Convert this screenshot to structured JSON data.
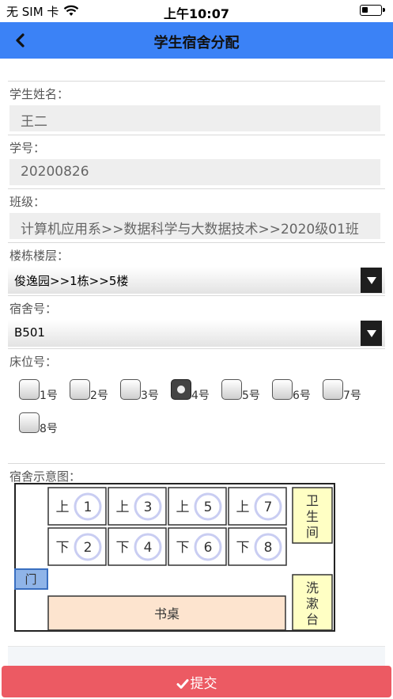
{
  "status": {
    "carrier": "无 SIM 卡",
    "time": "上午10:07"
  },
  "nav": {
    "title": "学生宿舍分配"
  },
  "form": {
    "name_label": "学生姓名：",
    "name_value": "王二",
    "id_label": "学号：",
    "id_value": "20200826",
    "class_label": "班级：",
    "class_value": "计算机应用系>>数据科学与大数据技术>>2020级01班",
    "building_label": "楼栋楼层：",
    "building_value": "俊逸园>>1栋>>5楼",
    "room_label": "宿舍号：",
    "room_value": "B501",
    "bed_label": "床位号：",
    "beds": [
      "1号",
      "2号",
      "3号",
      "4号",
      "5号",
      "6号",
      "7号",
      "8号"
    ],
    "selected_bed": "4号",
    "diagram_label": "宿舍示意图："
  },
  "diagram": {
    "upper": "上",
    "lower": "下",
    "upper_nums": [
      "1",
      "3",
      "5",
      "7"
    ],
    "lower_nums": [
      "2",
      "4",
      "6",
      "8"
    ],
    "toilet": "卫生间",
    "sink": "洗漱台",
    "door": "门",
    "desk": "书桌"
  },
  "submit_label": "提交",
  "colors": {
    "nav": "#3b82f6",
    "submit": "#ec5a63",
    "desk": "#fde4cf",
    "facility": "#ffffc4",
    "door": "#8fb4e8"
  }
}
